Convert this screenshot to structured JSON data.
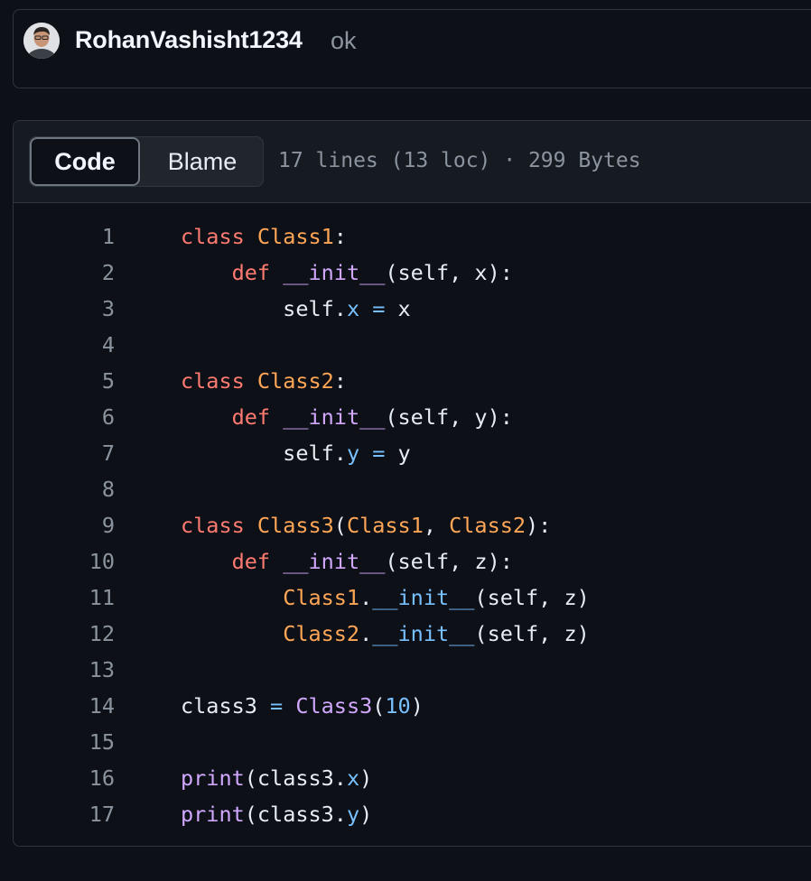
{
  "commit": {
    "author": "RohanVashisht1234",
    "message": "ok",
    "avatar_icon": "user-avatar"
  },
  "file_header": {
    "tabs": [
      {
        "label": "Code",
        "selected": true
      },
      {
        "label": "Blame",
        "selected": false
      }
    ],
    "info": "17 lines (13 loc) · 299 Bytes"
  },
  "code": {
    "language": "python",
    "lines": [
      {
        "n": "1",
        "tokens": [
          [
            "kw",
            "class"
          ],
          [
            "p",
            " "
          ],
          [
            "cls",
            "Class1"
          ],
          [
            "p",
            ":"
          ]
        ]
      },
      {
        "n": "2",
        "tokens": [
          [
            "p",
            "    "
          ],
          [
            "kw",
            "def"
          ],
          [
            "p",
            " "
          ],
          [
            "fn",
            "__init__"
          ],
          [
            "p",
            "(self, x):"
          ]
        ]
      },
      {
        "n": "3",
        "tokens": [
          [
            "p",
            "        self."
          ],
          [
            "attr",
            "x"
          ],
          [
            "p",
            " "
          ],
          [
            "op",
            "="
          ],
          [
            "p",
            " x"
          ]
        ]
      },
      {
        "n": "4",
        "tokens": []
      },
      {
        "n": "5",
        "tokens": [
          [
            "kw",
            "class"
          ],
          [
            "p",
            " "
          ],
          [
            "cls",
            "Class2"
          ],
          [
            "p",
            ":"
          ]
        ]
      },
      {
        "n": "6",
        "tokens": [
          [
            "p",
            "    "
          ],
          [
            "kw",
            "def"
          ],
          [
            "p",
            " "
          ],
          [
            "fn",
            "__init__"
          ],
          [
            "p",
            "(self, y):"
          ]
        ]
      },
      {
        "n": "7",
        "tokens": [
          [
            "p",
            "        self."
          ],
          [
            "attr",
            "y"
          ],
          [
            "p",
            " "
          ],
          [
            "op",
            "="
          ],
          [
            "p",
            " y"
          ]
        ]
      },
      {
        "n": "8",
        "tokens": []
      },
      {
        "n": "9",
        "tokens": [
          [
            "kw",
            "class"
          ],
          [
            "p",
            " "
          ],
          [
            "cls",
            "Class3"
          ],
          [
            "p",
            "("
          ],
          [
            "cls",
            "Class1"
          ],
          [
            "p",
            ", "
          ],
          [
            "cls",
            "Class2"
          ],
          [
            "p",
            "):"
          ]
        ]
      },
      {
        "n": "10",
        "tokens": [
          [
            "p",
            "    "
          ],
          [
            "kw",
            "def"
          ],
          [
            "p",
            " "
          ],
          [
            "fn",
            "__init__"
          ],
          [
            "p",
            "(self, z):"
          ]
        ]
      },
      {
        "n": "11",
        "tokens": [
          [
            "p",
            "        "
          ],
          [
            "cls",
            "Class1"
          ],
          [
            "p",
            "."
          ],
          [
            "attr",
            "__init__"
          ],
          [
            "p",
            "(self, z)"
          ]
        ]
      },
      {
        "n": "12",
        "tokens": [
          [
            "p",
            "        "
          ],
          [
            "cls",
            "Class2"
          ],
          [
            "p",
            "."
          ],
          [
            "attr",
            "__init__"
          ],
          [
            "p",
            "(self, z)"
          ]
        ]
      },
      {
        "n": "13",
        "tokens": []
      },
      {
        "n": "14",
        "tokens": [
          [
            "p",
            "class3 "
          ],
          [
            "op",
            "="
          ],
          [
            "p",
            " "
          ],
          [
            "fn",
            "Class3"
          ],
          [
            "p",
            "("
          ],
          [
            "num",
            "10"
          ],
          [
            "p",
            ")"
          ]
        ]
      },
      {
        "n": "15",
        "tokens": []
      },
      {
        "n": "16",
        "tokens": [
          [
            "fn",
            "print"
          ],
          [
            "p",
            "(class3."
          ],
          [
            "attr",
            "x"
          ],
          [
            "p",
            ")"
          ]
        ]
      },
      {
        "n": "17",
        "tokens": [
          [
            "fn",
            "print"
          ],
          [
            "p",
            "(class3."
          ],
          [
            "attr",
            "y"
          ],
          [
            "p",
            ")"
          ]
        ]
      }
    ]
  },
  "colors": {
    "background": "#0d1117",
    "keyword": "#ff7b72",
    "class_name": "#ffa657",
    "function": "#d2a8ff",
    "attribute": "#79c0ff",
    "text": "#e6edf3",
    "muted": "#8b949e"
  }
}
